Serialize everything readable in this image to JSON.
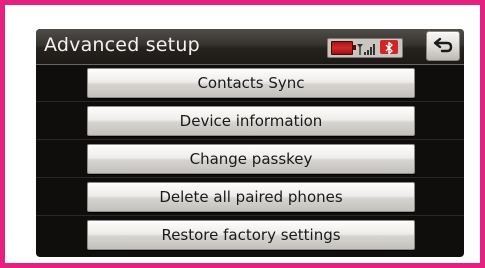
{
  "screen": {
    "title": "Advanced setup"
  },
  "status": {
    "icons": [
      "battery-icon",
      "signal-icon",
      "bluetooth-icon"
    ],
    "battery_color": "#d02626",
    "bluetooth_color": "#d02626"
  },
  "back_button": {
    "icon": "back-arrow-icon"
  },
  "menu": {
    "items": [
      {
        "label": "Contacts Sync"
      },
      {
        "label": "Device information"
      },
      {
        "label": "Change passkey"
      },
      {
        "label": "Delete all paired phones"
      },
      {
        "label": "Restore factory settings"
      }
    ]
  },
  "colors": {
    "frame_border": "#e6207f",
    "screen_background": "#100d0d",
    "button_face": "#eeedeb"
  }
}
